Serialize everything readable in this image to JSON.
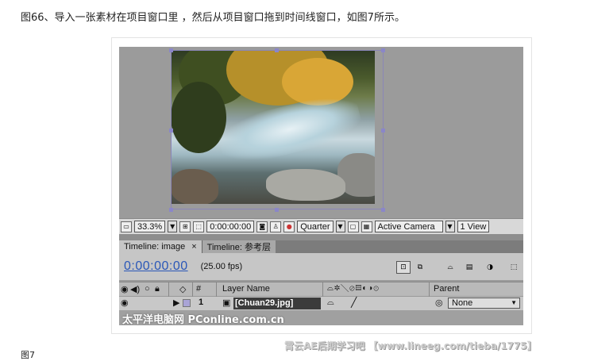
{
  "intro_text": "图66、导入一张素材在项目窗口里 ，然后从项目窗口拖到时间线窗口，如图7所示。",
  "comp_bar": {
    "zoom": "33.3%",
    "timecode": "0:00:00:00",
    "resolution": "Quarter",
    "camera": "Active Camera",
    "view": "1 View"
  },
  "tabs": [
    {
      "label": "Timeline: image",
      "close": "×"
    },
    {
      "label": "Timeline: 参考层"
    }
  ],
  "timeline": {
    "current_time": "0:00:00:00",
    "fps": "(25.00 fps)"
  },
  "columns": {
    "number": "#",
    "layer_name": "Layer Name",
    "parent": "Parent"
  },
  "layer": {
    "index": "1",
    "name": "[Chuan29.jpg]",
    "parent_value": "None"
  },
  "watermark_left": "太平洋电脑网 PConline.com.cn",
  "watermark_right": "霄云AE后期学习吧 【www.lineeg.com/tieba/1775】",
  "caption": "图7",
  "colors": {
    "timecode_blue": "#2a57b8",
    "selection_box": "#8a86b8",
    "panel_gray": "#c6c6c6"
  }
}
